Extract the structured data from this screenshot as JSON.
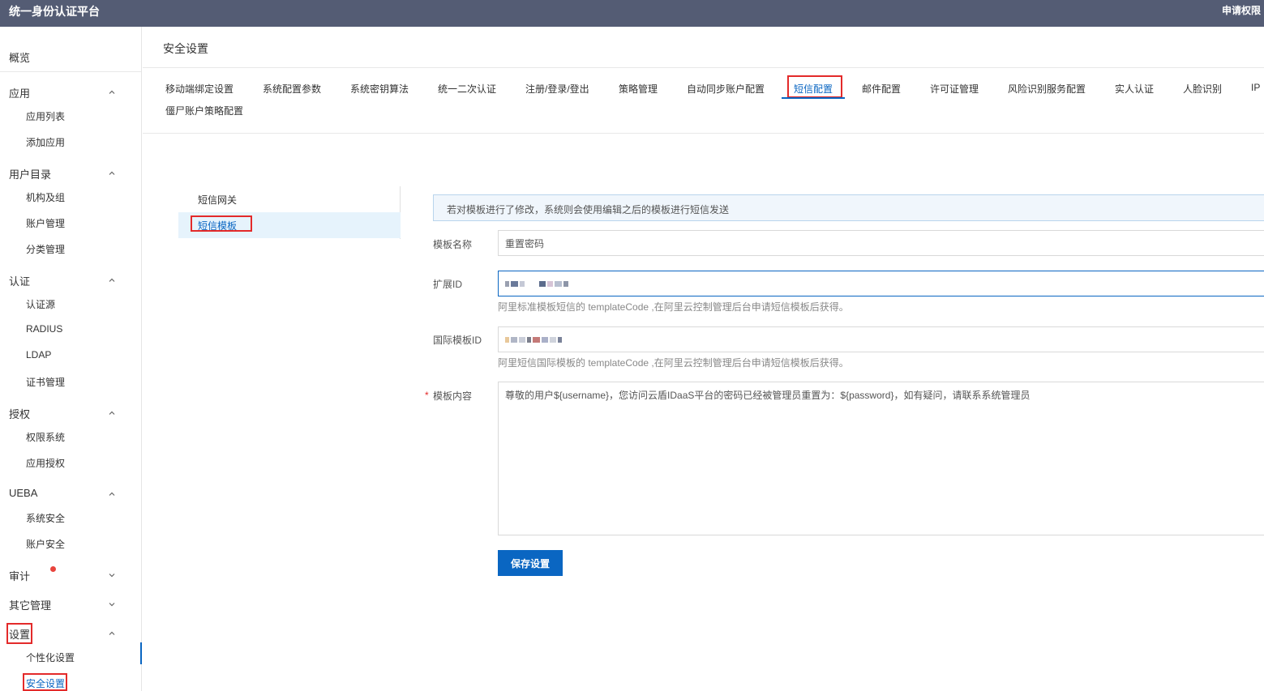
{
  "header": {
    "app_title": "统一身份认证平台",
    "apply_permission": "申请权限"
  },
  "sidebar": {
    "overview": "概览",
    "groups": [
      {
        "label": "应用",
        "expanded": true,
        "items": [
          "应用列表",
          "添加应用"
        ]
      },
      {
        "label": "用户目录",
        "expanded": true,
        "items": [
          "机构及组",
          "账户管理",
          "分类管理"
        ]
      },
      {
        "label": "认证",
        "expanded": true,
        "items": [
          "认证源",
          "RADIUS",
          "LDAP",
          "证书管理"
        ]
      },
      {
        "label": "授权",
        "expanded": true,
        "items": [
          "权限系统",
          "应用授权"
        ]
      },
      {
        "label": "UEBA",
        "expanded": true,
        "items": [
          "系统安全",
          "账户安全"
        ]
      },
      {
        "label": "审计",
        "expanded": false,
        "items": []
      },
      {
        "label": "其它管理",
        "expanded": false,
        "items": []
      },
      {
        "label": "设置",
        "expanded": true,
        "items": [
          "个性化设置",
          "安全设置"
        ]
      }
    ],
    "active_item": "安全设置"
  },
  "main": {
    "page_title": "安全设置",
    "tabs": [
      "移动端绑定设置",
      "系统配置参数",
      "系统密钥算法",
      "统一二次认证",
      "注册/登录/登出",
      "策略管理",
      "自动同步账户配置",
      "短信配置",
      "邮件配置",
      "许可证管理",
      "风险识别服务配置",
      "实人认证",
      "人脸识别",
      "IP⁠"
    ],
    "tabs_row2": [
      "僵尸账户策略配置"
    ],
    "active_tab": "短信配置",
    "subnav": [
      "短信网关",
      "短信模板"
    ],
    "active_subnav": "短信模板",
    "notice": "若对模板进行了修改，系统则会使用编辑之后的模板进行短信发送",
    "form": {
      "template_name_label": "模板名称",
      "template_name_value": "重置密码",
      "ext_id_label": "扩展ID",
      "ext_id_help": "阿里标准模板短信的 templateCode ,在阿里云控制管理后台申请短信模板后获得。",
      "intl_id_label": "国际模板ID",
      "intl_id_help": "阿里短信国际模板的 templateCode ,在阿里云控制管理后台申请短信模板后获得。",
      "content_label": "模板内容",
      "content_required": "*",
      "content_value": "尊敬的用户${username}，您访问云盾IDaaS平台的密码已经被管理员重置为：${password}，如有疑问，请联系系统管理员",
      "save_label": "保存设置"
    }
  },
  "colors": {
    "topbar": "#545c74",
    "accent": "#0a66c2",
    "highlight": "#e32a2a",
    "badge": "#e8443d"
  }
}
